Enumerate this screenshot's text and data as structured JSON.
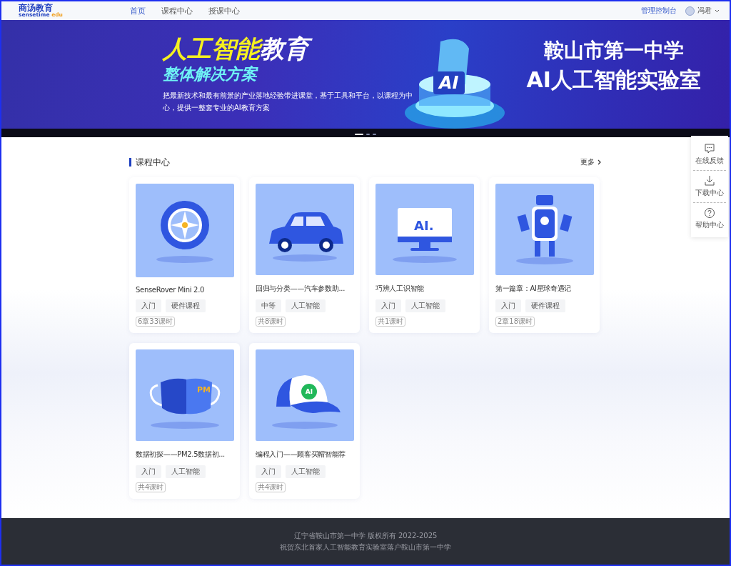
{
  "header": {
    "logo": {
      "name": "商汤教育",
      "sub_prefix": "sensetime",
      "sub_suffix": "edu"
    },
    "nav": [
      {
        "label": "首页",
        "selected": true
      },
      {
        "label": "课程中心",
        "selected": false
      },
      {
        "label": "授课中心",
        "selected": false
      }
    ],
    "console_link": "管理控制台",
    "user": {
      "name": "冯君"
    }
  },
  "banner": {
    "title_highlight": "人工智能",
    "title_rest": "教育",
    "subtitle": "整体解决方案",
    "description": "把最新技术和最有前景的产业落地经验带进课堂，基于工具和平台，以课程为中心，提供一整套专业的AI教育方案",
    "art_text": "AI",
    "school": "鞍山市第一中学",
    "lab": "AI人工智能实验室",
    "carousel": [
      {
        "selected": true
      },
      {
        "selected": false
      },
      {
        "selected": false
      }
    ]
  },
  "courses": {
    "title": "课程中心",
    "more": "更多",
    "items": [
      {
        "kind": "wheel",
        "title": "SenseRover Mini 2.0",
        "tags": [
          "入门",
          "硬件课程"
        ],
        "lessons": "6章33课时"
      },
      {
        "kind": "car",
        "title": "回归与分类——汽车参数助...",
        "tags": [
          "中等",
          "人工智能"
        ],
        "lessons": "共8课时"
      },
      {
        "kind": "monitor",
        "art_text": "AI.",
        "title": "巧辨人工识智能",
        "tags": [
          "入门",
          "人工智能"
        ],
        "lessons": "共1课时"
      },
      {
        "kind": "robot",
        "title": "第一篇章：AI星球奇遇记",
        "tags": [
          "入门",
          "硬件课程"
        ],
        "lessons": "2章18课时"
      },
      {
        "kind": "mask",
        "art_text": "PM",
        "title": "数据初探——PM2.5数据初...",
        "tags": [
          "入门",
          "人工智能"
        ],
        "lessons": "共4课时"
      },
      {
        "kind": "cap",
        "art_text": "AI",
        "title": "编程入门——顾客买帽智能荐",
        "tags": [
          "入门",
          "人工智能"
        ],
        "lessons": "共4课时"
      }
    ]
  },
  "side_tools": [
    {
      "kind": "chat",
      "label": "在线反馈"
    },
    {
      "kind": "download",
      "label": "下载中心"
    },
    {
      "kind": "help",
      "label": "帮助中心"
    }
  ],
  "footer": {
    "lines": [
      "辽宁省鞍山市第一中学 版权所有 2022-2025",
      "祝贺东北首家人工智能教育实验室落户鞍山市第一中学"
    ]
  }
}
